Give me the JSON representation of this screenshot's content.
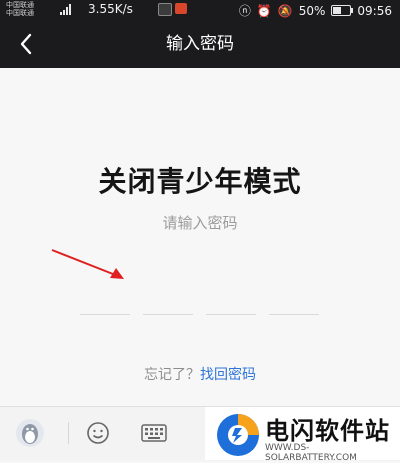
{
  "status_bar": {
    "carrier_1": "中国联通",
    "carrier_2": "中国联通",
    "network_speed": "3.55K/s",
    "battery_percent": "50%",
    "battery_level": 0.5,
    "time": "09:56"
  },
  "nav_bar": {
    "title": "输入密码"
  },
  "main": {
    "title": "关闭青少年模式",
    "subtitle": "请输入密码",
    "pin_slots": 4,
    "forgot_prefix": "忘记了？",
    "forgot_link": "找回密码"
  },
  "watermark": {
    "name": "电闪软件站",
    "url": "WWW.DS-SOLARBATTERY.COM"
  },
  "colors": {
    "header_bg": "#1b1b1d",
    "link": "#2d74d8",
    "arrow": "#e02020"
  }
}
